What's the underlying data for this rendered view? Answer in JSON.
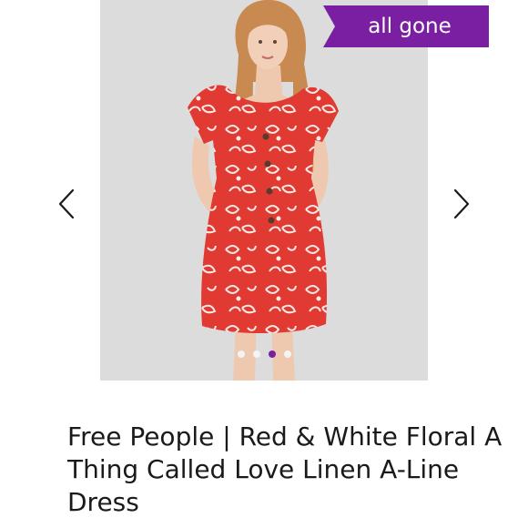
{
  "listing": {
    "status_badge": "all gone",
    "title": "Free People | Red & White Floral A Thing Called Love Linen A-Line Dress"
  },
  "carousel": {
    "dot_count": 4,
    "active_index": 2
  },
  "colors": {
    "accent": "#7b1fa2",
    "dress_red": "#e03a33",
    "photo_bg": "#dcdcdc"
  },
  "icons": {
    "prev": "chevron-left-icon",
    "next": "chevron-right-icon"
  }
}
